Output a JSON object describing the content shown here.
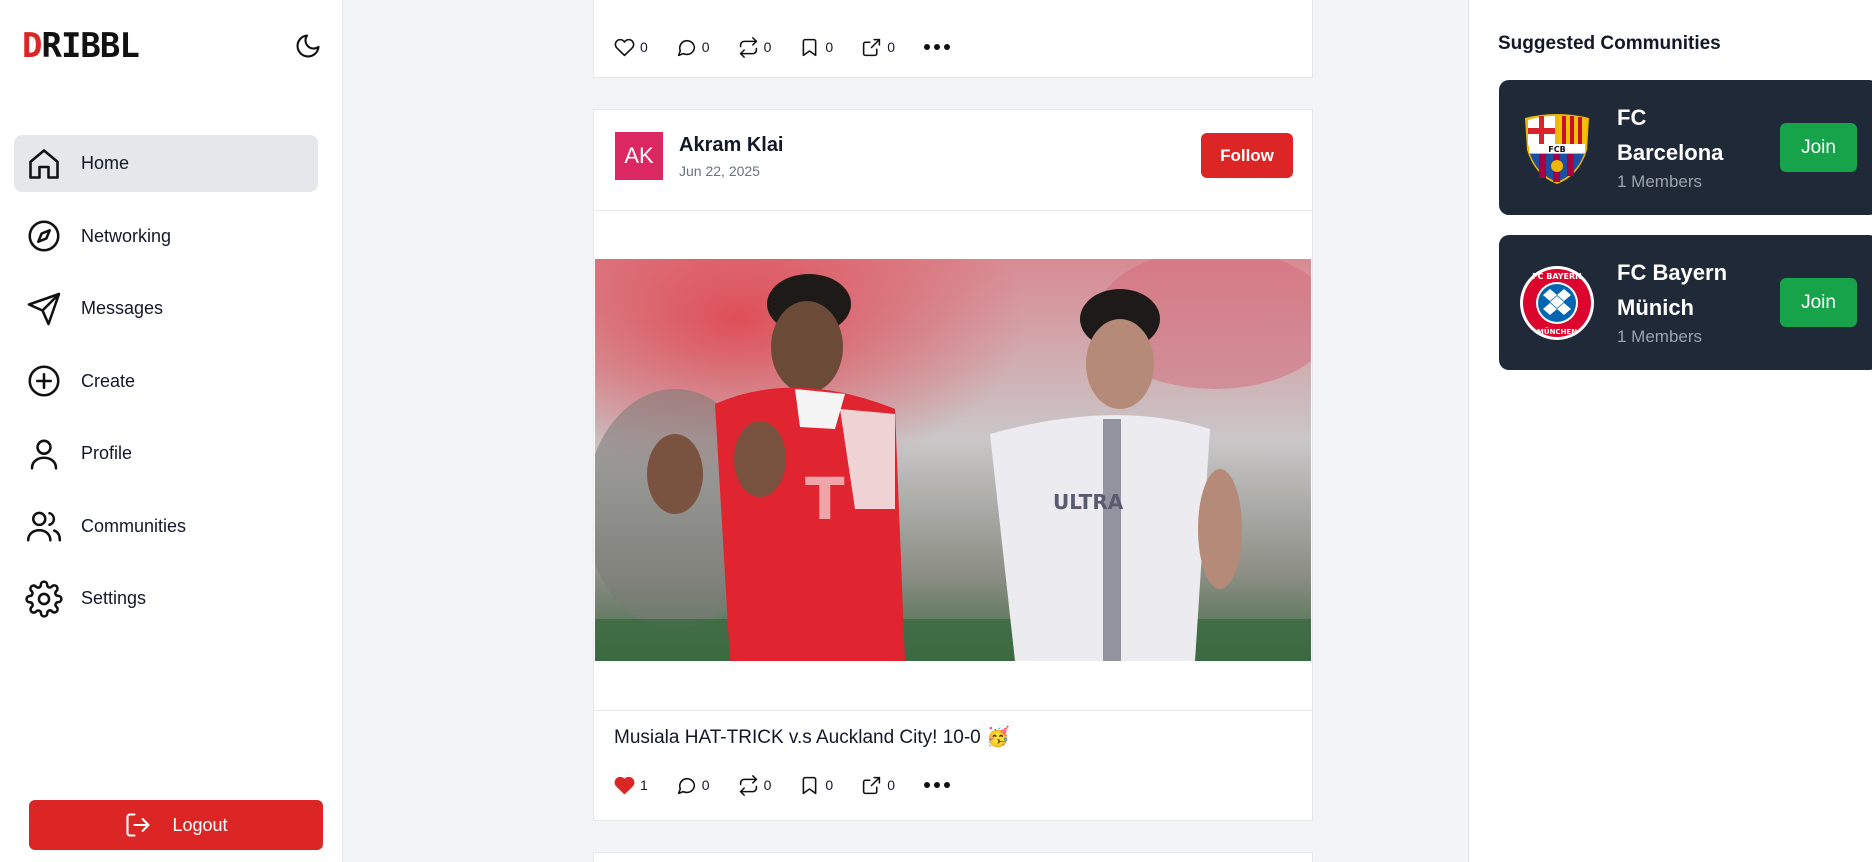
{
  "app": {
    "logo_first": "D",
    "logo_rest": "RIBBL"
  },
  "sidebar": {
    "items": [
      {
        "label": "Home",
        "icon": "home-icon",
        "active": true
      },
      {
        "label": "Networking",
        "icon": "compass-icon"
      },
      {
        "label": "Messages",
        "icon": "send-icon"
      },
      {
        "label": "Create",
        "icon": "plus-circle-icon"
      },
      {
        "label": "Profile",
        "icon": "user-icon"
      },
      {
        "label": "Communities",
        "icon": "users-icon"
      },
      {
        "label": "Settings",
        "icon": "gear-icon"
      }
    ],
    "logout_label": "Logout"
  },
  "feed": {
    "top_post": {
      "likes": "0",
      "comments": "0",
      "reposts": "0",
      "bookmarks": "0",
      "shares": "0"
    },
    "main_post": {
      "avatar_initials": "AK",
      "author": "Akram Klai",
      "date": "Jun 22, 2025",
      "follow_label": "Follow",
      "caption": "Musiala HAT-TRICK v.s Auckland City! 10-0 🥳",
      "likes": "1",
      "comments": "0",
      "reposts": "0",
      "bookmarks": "0",
      "shares": "0",
      "liked": true
    }
  },
  "right_panel": {
    "title": "Suggested Communities",
    "communities": [
      {
        "name": "FC Barcelona",
        "members": "1 Members",
        "join_label": "Join",
        "crest": "fc-barcelona-crest"
      },
      {
        "name": "FC Bayern Münich",
        "members": "1 Members",
        "join_label": "Join",
        "crest": "fc-bayern-crest"
      }
    ]
  },
  "colors": {
    "brand_red": "#dc2626",
    "join_green": "#16a34a",
    "card_dark": "#1f2937",
    "avatar_pink": "#db2762"
  }
}
